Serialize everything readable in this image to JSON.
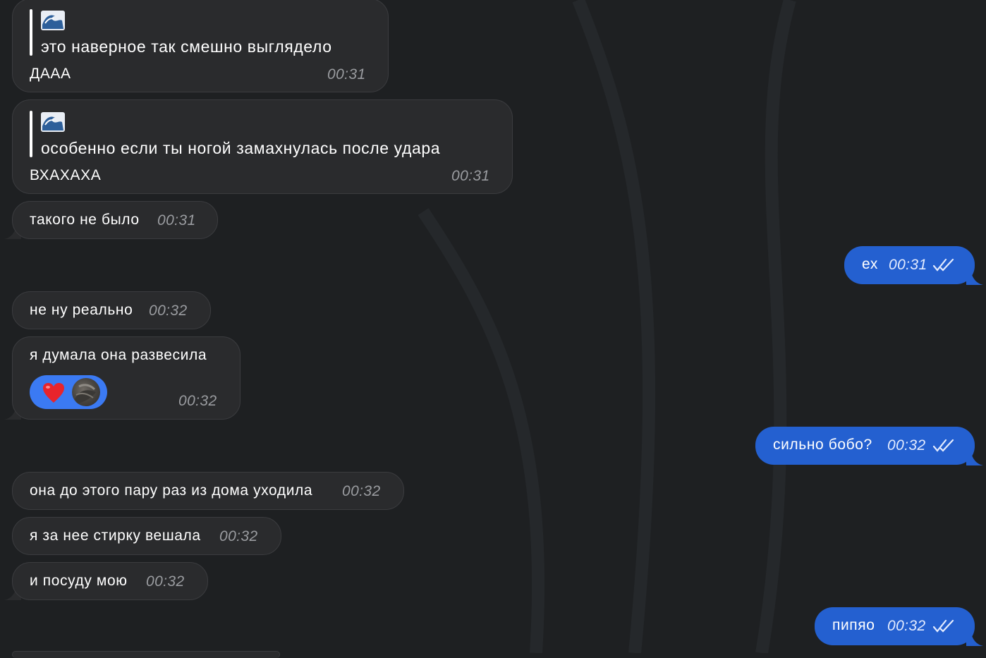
{
  "messages": [
    {
      "quote": {
        "emoji_icon": "wave-emoji-icon",
        "text": "это наверное так смешно выглядело"
      },
      "text": "ДААА",
      "time": "00:31"
    },
    {
      "quote": {
        "emoji_icon": "wave-emoji-icon",
        "text": "особенно если ты ногой замахнулась после удара"
      },
      "text": "ВХАХАХА",
      "time": "00:31"
    },
    {
      "text": "такого не было",
      "time": "00:31"
    },
    {
      "text": "ех",
      "time": "00:31",
      "read_icon": "double-check-icon"
    },
    {
      "text": "не ну реально",
      "time": "00:32"
    },
    {
      "text": "я думала она развесила",
      "time": "00:32",
      "reactions": [
        "heart-icon",
        "avatar"
      ]
    },
    {
      "text": "сильно бобо?",
      "time": "00:32",
      "read_icon": "double-check-icon"
    },
    {
      "text": "она до этого пару раз из дома уходила",
      "time": "00:32"
    },
    {
      "text": "я за нее стирку вешала",
      "time": "00:32"
    },
    {
      "text": "и посуду мою",
      "time": "00:32"
    },
    {
      "text": "пипяо",
      "time": "00:32",
      "read_icon": "double-check-icon"
    }
  ],
  "colors": {
    "background": "#1e2022",
    "incoming_bubble": "#2a2b2d",
    "outgoing_bubble": "#2460d0",
    "reaction_pill": "#3b7af3"
  }
}
